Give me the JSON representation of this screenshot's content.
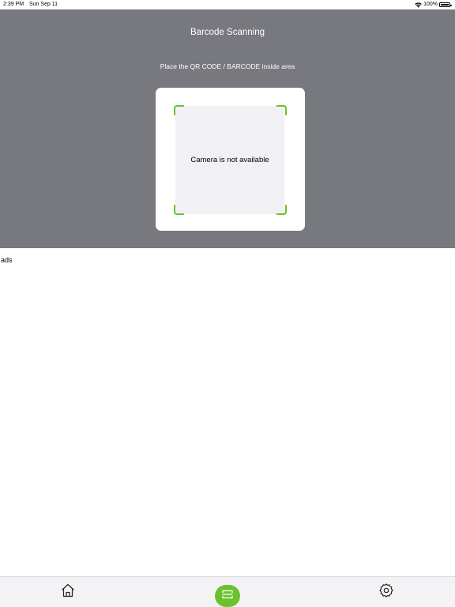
{
  "status_bar": {
    "time": "2:39 PM",
    "date": "Sun Sep 11",
    "battery_text": "100%",
    "battery_level_percent": 100,
    "icons": [
      "wifi-icon",
      "battery-icon"
    ]
  },
  "scanner": {
    "title": "Barcode Scanning",
    "instruction": "Place the QR CODE / BARCODE inside area",
    "camera_message": "Camera is not available"
  },
  "ads": {
    "label": "ads"
  },
  "tab_bar": {
    "items": [
      {
        "icon": "home-icon",
        "active": false
      },
      {
        "icon": "scan-icon",
        "active": true
      },
      {
        "icon": "gear-icon",
        "active": false
      }
    ]
  },
  "colors": {
    "panel_background": "#78787f",
    "accent": "#6cc22e",
    "camera_area": "#f1f1f5",
    "tab_bar_background": "#f3f3f5"
  }
}
